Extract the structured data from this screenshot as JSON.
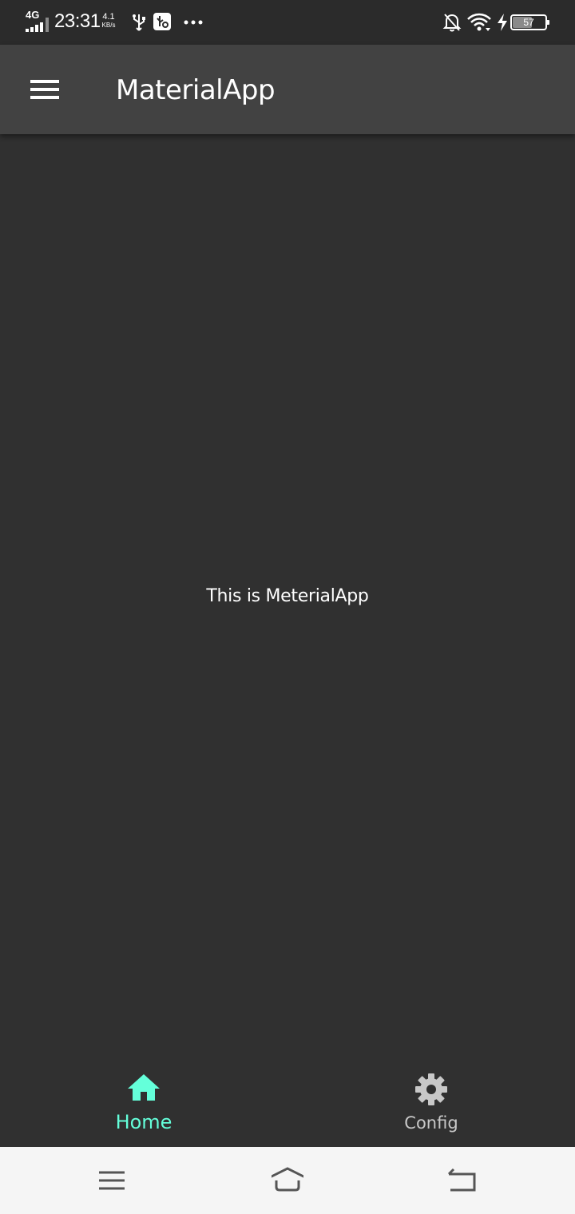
{
  "status_bar": {
    "network": "4G",
    "time": "23:31",
    "speed_value": "4.1",
    "speed_unit": "KB/s",
    "battery_level": "57",
    "icons": [
      "usb-icon",
      "usb-debug-icon",
      "more-notifications-icon",
      "bell-off-icon",
      "wifi-icon",
      "charging-icon",
      "battery-icon"
    ]
  },
  "app_bar": {
    "title": "MaterialApp",
    "menu_icon": "menu-icon"
  },
  "body": {
    "text": "This is MeterialApp"
  },
  "bottom_nav": {
    "items": [
      {
        "label": "Home",
        "icon": "home-icon",
        "selected": true
      },
      {
        "label": "Config",
        "icon": "gear-icon",
        "selected": false
      }
    ]
  },
  "system_nav": {
    "buttons": [
      "menu-icon",
      "home-icon",
      "back-icon"
    ]
  },
  "colors": {
    "background": "#303030",
    "app_bar": "#424242",
    "accent": "#64ffda",
    "inactive": "#c8c8c8",
    "system_nav": "#f5f5f5"
  }
}
